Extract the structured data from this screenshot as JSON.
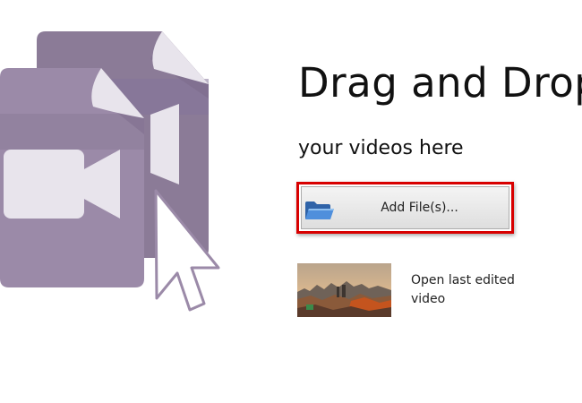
{
  "drop_zone": {
    "title": "Drag and Drop",
    "subtitle": "your videos here"
  },
  "add_files": {
    "label": "Add File(s)...",
    "icon": "folder-icon"
  },
  "recent": {
    "label": "Open last edited video",
    "thumbnail_icon": "video-thumbnail"
  },
  "colors": {
    "doc_back": "#8b7b97",
    "doc_front": "#9b8aa8",
    "doc_band": "#8a7a96",
    "doc_fold": "#e8e4ec",
    "camera_glyph": "#e8e4ec",
    "highlight_border": "#d80000",
    "folder": "#3a78c9"
  }
}
